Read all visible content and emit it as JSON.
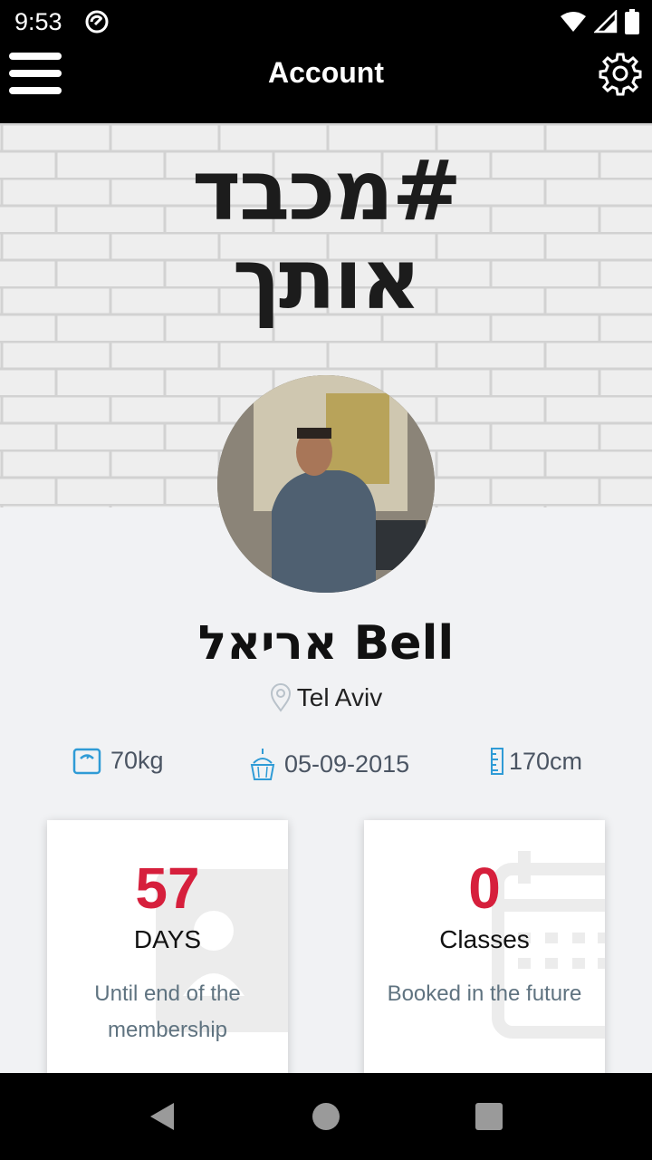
{
  "status_bar": {
    "time": "9:53",
    "icons": [
      "sync-icon",
      "wifi-icon",
      "signal-icon",
      "battery-icon"
    ]
  },
  "app_bar": {
    "title": "Account",
    "left_icon": "hamburger-menu-icon",
    "right_icon": "gear-icon"
  },
  "banner": {
    "logo_line1": "#מכבד",
    "logo_line2": "אותך"
  },
  "profile": {
    "name": "אריאל Bell",
    "location": "Tel Aviv"
  },
  "stats": {
    "weight": "70kg",
    "birthdate": "05-09-2015",
    "height": "170cm"
  },
  "cards": [
    {
      "number": "57",
      "unit": "DAYS",
      "description": "Until end of the membership"
    },
    {
      "number": "0",
      "unit": "Classes",
      "description": "Booked in the future"
    }
  ],
  "colors": {
    "accent": "#d61f3c",
    "icon_blue": "#2f9bd6",
    "background": "#f1f2f4"
  }
}
